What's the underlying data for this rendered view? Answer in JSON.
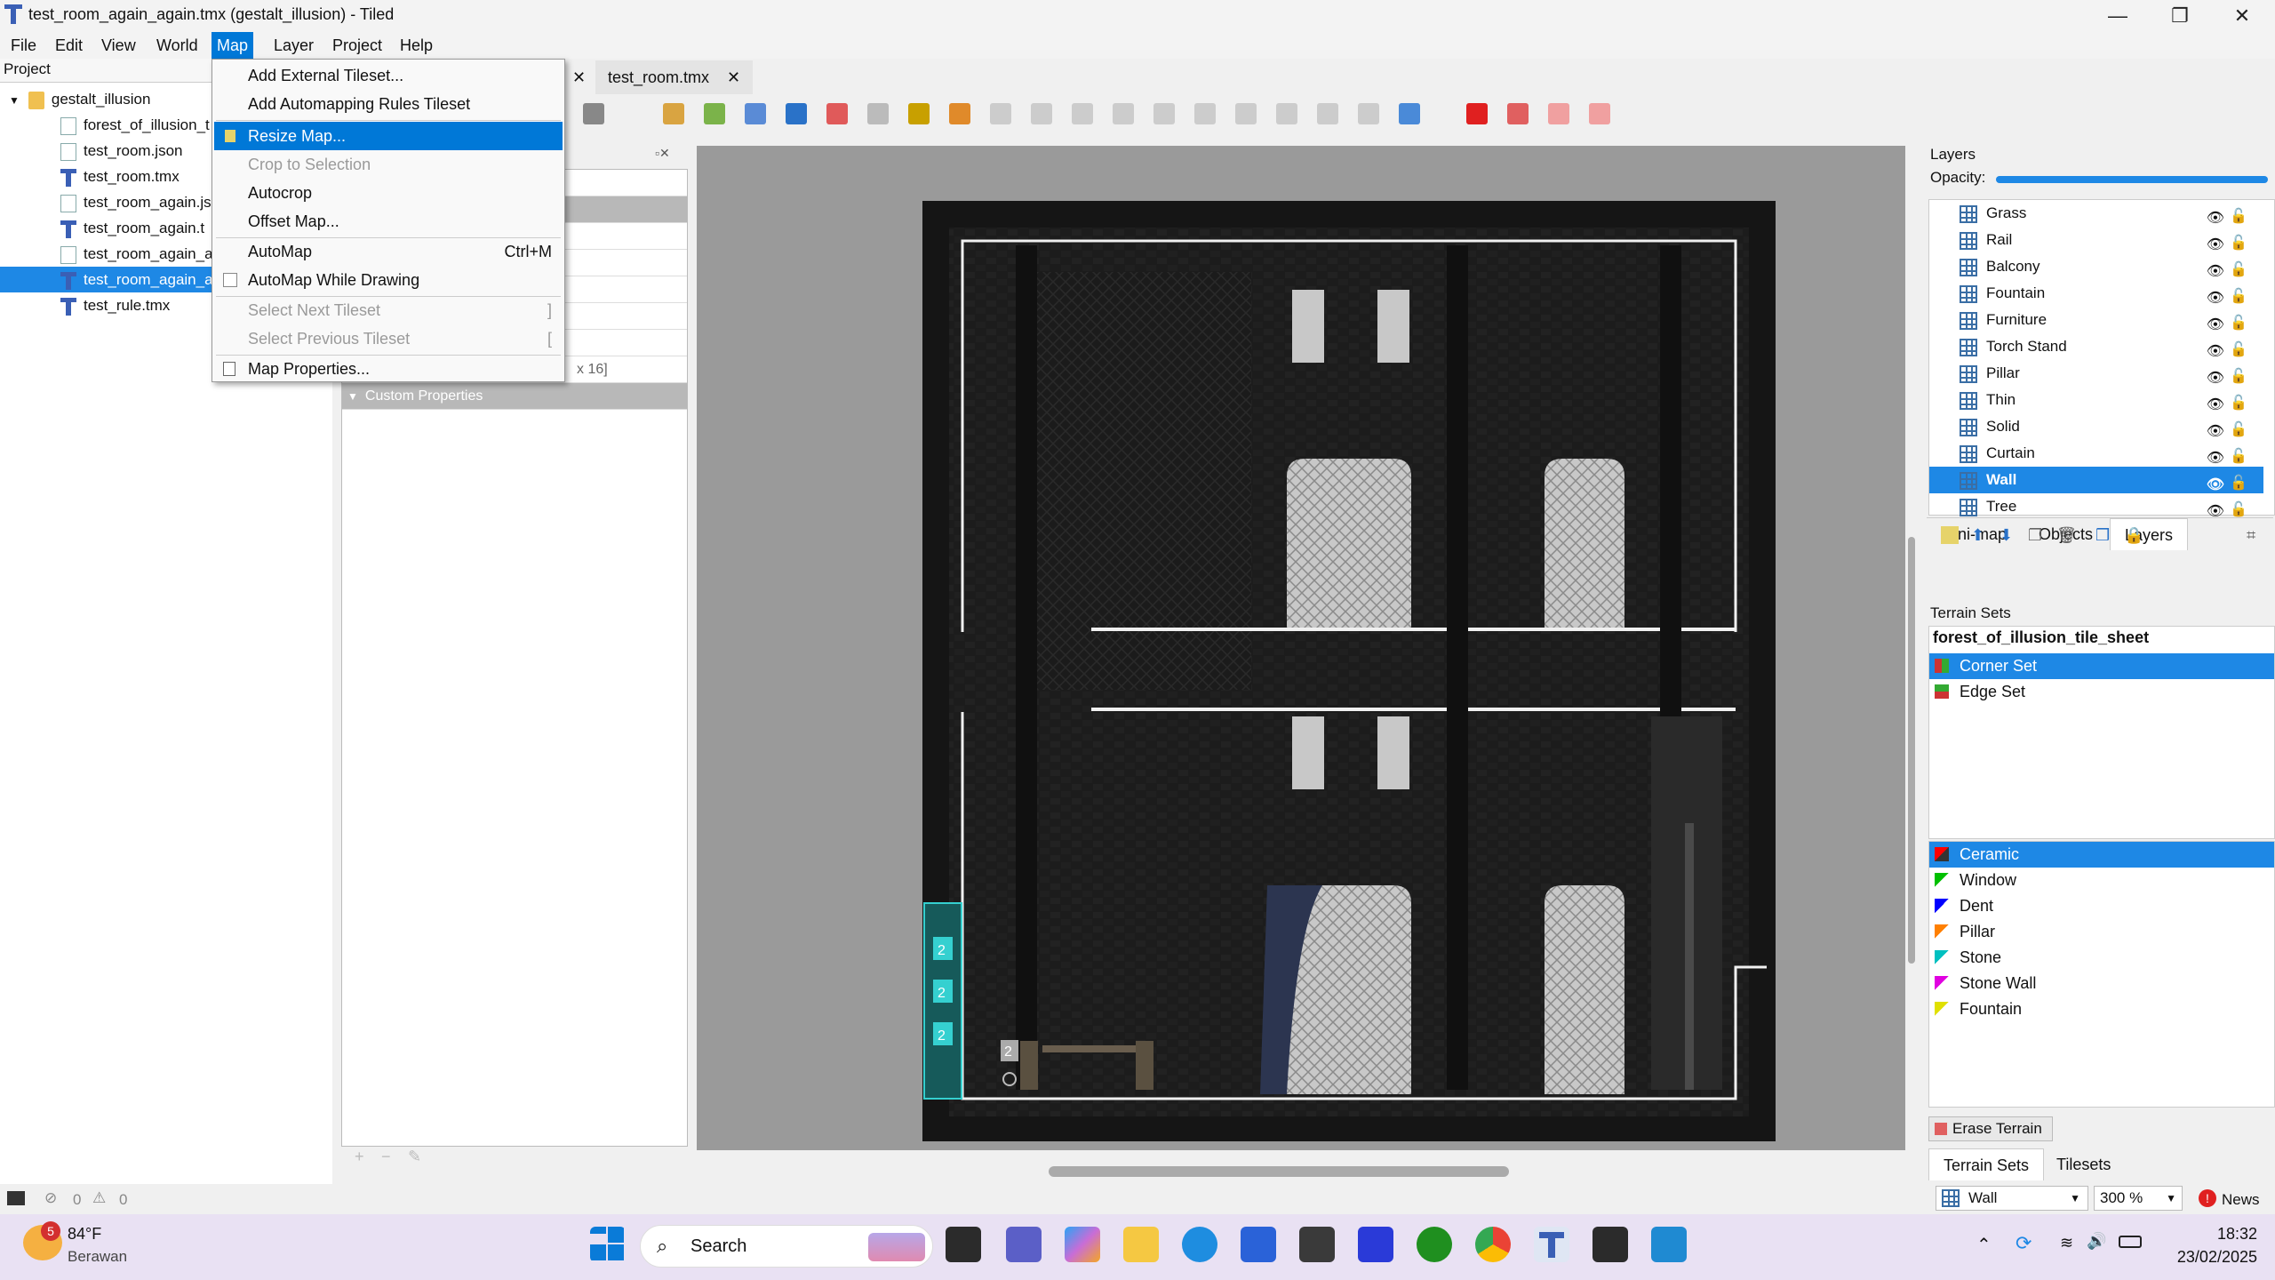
{
  "window": {
    "title": "test_room_again_again.tmx (gestalt_illusion) - Tiled",
    "minimize_glyph": "—",
    "maximize_glyph": "❐",
    "close_glyph": "✕"
  },
  "menubar": [
    "File",
    "Edit",
    "View",
    "World",
    "Map",
    "Layer",
    "Project",
    "Help"
  ],
  "map_menu": {
    "items": [
      {
        "label": "Add External Tileset...",
        "disabled": false
      },
      {
        "label": "Add Automapping Rules Tileset",
        "disabled": false
      },
      {
        "label": "Resize Map...",
        "disabled": false,
        "highlight": true
      },
      {
        "label": "Crop to Selection",
        "disabled": true
      },
      {
        "label": "Autocrop",
        "disabled": false
      },
      {
        "label": "Offset Map...",
        "disabled": false
      },
      {
        "label": "AutoMap",
        "shortcut": "Ctrl+M"
      },
      {
        "label": "AutoMap While Drawing",
        "checkbox": true
      },
      {
        "label": "Select Next Tileset",
        "shortcut": "]",
        "disabled": true
      },
      {
        "label": "Select Previous Tileset",
        "shortcut": "[",
        "disabled": true
      },
      {
        "label": "Map Properties..."
      }
    ]
  },
  "project": {
    "header": "Project",
    "root": "gestalt_illusion",
    "files": [
      {
        "name": "forest_of_illusion_t",
        "type": "tsx"
      },
      {
        "name": "test_room.json",
        "type": "json"
      },
      {
        "name": "test_room.tmx",
        "type": "tmx"
      },
      {
        "name": "test_room_again.js",
        "type": "json"
      },
      {
        "name": "test_room_again.t",
        "type": "tmx"
      },
      {
        "name": "test_room_again_a",
        "type": "json"
      },
      {
        "name": "test_room_again_a",
        "type": "tmx",
        "selected": true
      },
      {
        "name": "test_rule.tmx",
        "type": "tmx"
      }
    ]
  },
  "properties": {
    "size_fragment": "x 16]",
    "custom_properties": "Custom Properties"
  },
  "tabs": [
    {
      "label": "test_room.tmx"
    }
  ],
  "layers": {
    "title": "Layers",
    "opacity_label": "Opacity:",
    "opacity": 1.0,
    "items": [
      "Grass",
      "Rail",
      "Balcony",
      "Fountain",
      "Furniture",
      "Torch Stand",
      "Pillar",
      "Thin",
      "Solid",
      "Curtain",
      "Wall",
      "Tree"
    ],
    "selected": "Wall",
    "tabs": [
      "Mini-map",
      "Objects",
      "Layers"
    ]
  },
  "terrain": {
    "title": "Terrain Sets",
    "tileset": "forest_of_illusion_tile_sheet",
    "sets": [
      {
        "name": "Corner Set",
        "selected": true
      },
      {
        "name": "Edge Set"
      }
    ],
    "terrains": [
      {
        "name": "Ceramic",
        "color": "#ff0000",
        "selected": true
      },
      {
        "name": "Window",
        "color": "#00c000"
      },
      {
        "name": "Dent",
        "color": "#0000ff"
      },
      {
        "name": "Pillar",
        "color": "#ff8000"
      },
      {
        "name": "Stone",
        "color": "#00c0c0"
      },
      {
        "name": "Stone Wall",
        "color": "#e000e0"
      },
      {
        "name": "Fountain",
        "color": "#e0e000"
      }
    ],
    "erase": "Erase Terrain",
    "bottom_tabs": [
      "Terrain Sets",
      "Tilesets"
    ]
  },
  "statusbar": {
    "errors": "0",
    "warnings": "0",
    "layer": "Wall",
    "zoom": "300 %",
    "news": "News"
  },
  "map_labels": [
    "2",
    "2",
    "2",
    "2"
  ],
  "taskbar": {
    "weather_temp": "84°F",
    "weather_desc": "Berawan",
    "weather_badge": "5",
    "search": "Search",
    "time": "18:32",
    "date": "23/02/2025"
  },
  "colors": {
    "accent": "#0078d7",
    "selection": "#1e88e5"
  }
}
